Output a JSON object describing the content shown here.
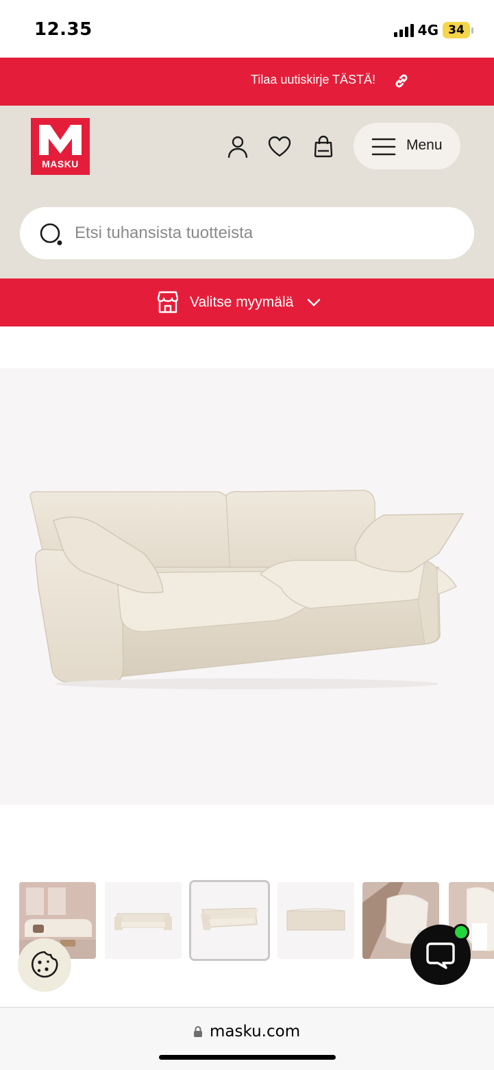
{
  "status_bar": {
    "time": "12.35",
    "network": "4G",
    "battery": "34",
    "signal_bars": 4
  },
  "promo": {
    "text": "Tilaa uutiskirje TÄSTÄ!",
    "link_icon": "link-icon"
  },
  "brand": {
    "logo_text": "MASKU",
    "color": "#e41e3a"
  },
  "header": {
    "account_icon": "user-icon",
    "wishlist_icon": "heart-icon",
    "cart_icon": "shopping-bag-icon",
    "menu_label": "Menu"
  },
  "search": {
    "placeholder": "Etsi tuhansista tuotteista"
  },
  "store_selector": {
    "label": "Valitse myymälä",
    "icon": "store-icon"
  },
  "gallery": {
    "thumbnails": [
      {
        "name": "living-room-photo",
        "selected": false
      },
      {
        "name": "sofa-front",
        "selected": false
      },
      {
        "name": "sofa-angle",
        "selected": true
      },
      {
        "name": "sofa-back",
        "selected": false
      },
      {
        "name": "cushion-detail",
        "selected": false
      },
      {
        "name": "cushion-closeup",
        "selected": false
      }
    ]
  },
  "widgets": {
    "cookie_icon": "cookie-icon",
    "chat_icon": "chat-icon"
  },
  "browser": {
    "url": "masku.com"
  }
}
